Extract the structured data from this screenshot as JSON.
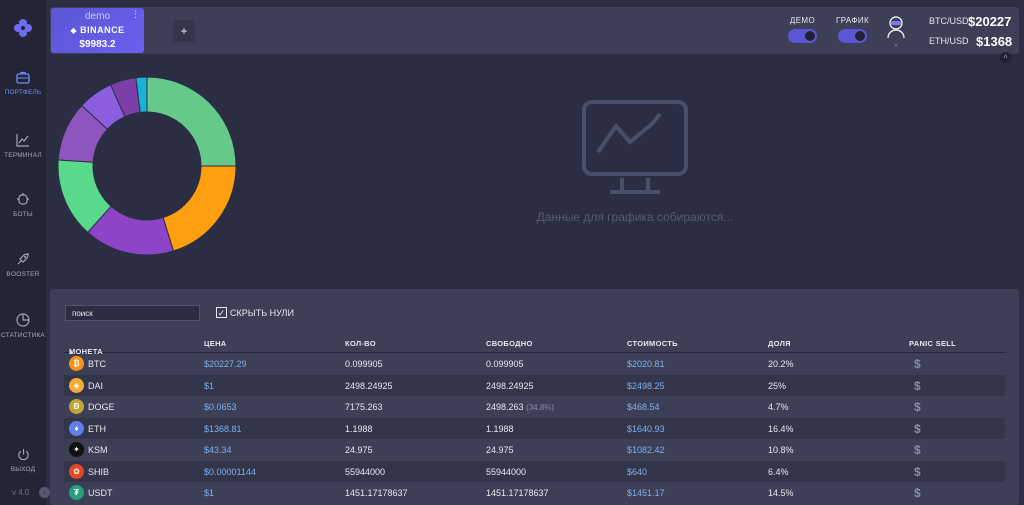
{
  "sidebar": {
    "items": [
      {
        "label": "ПОРТФЕЛЬ",
        "icon": "briefcase-icon",
        "active": true
      },
      {
        "label": "ТЕРМИНАЛ",
        "icon": "chart-line-icon",
        "active": false
      },
      {
        "label": "БОТЫ",
        "icon": "robot-icon",
        "active": false
      },
      {
        "label": "BOOSTER",
        "icon": "rocket-icon",
        "active": false
      },
      {
        "label": "СТАТИСТИКА",
        "icon": "pie-chart-icon",
        "active": false
      }
    ],
    "logout_label": "ВЫХОД",
    "version": "v 4.0"
  },
  "topbar": {
    "account": {
      "mode": "demo",
      "exchange": "BINANCE",
      "balance": "$9983.2"
    },
    "add_label": "+",
    "toggles": [
      {
        "label": "ДЕМО",
        "on": true
      },
      {
        "label": "ГРАФИК",
        "on": true
      }
    ],
    "tickers": [
      {
        "pair": "BTC/USD",
        "price": "$20227"
      },
      {
        "pair": "ETH/USD",
        "price": "$1368"
      }
    ]
  },
  "graph": {
    "message": "Данные для графика собираются..."
  },
  "table": {
    "search_placeholder": "поиск",
    "hide_zero_label": "СКРЫТЬ НУЛИ",
    "headers": {
      "coin": "МОНЕТА",
      "price": "ЦЕНА",
      "qty": "КОЛ-ВО",
      "free": "СВОБОДНО",
      "value": "СТОИМОСТЬ",
      "share": "ДОЛЯ",
      "panic": "PANIC SELL"
    },
    "rows": [
      {
        "coin": "BTC",
        "price": "$20227.29",
        "qty": "0.099905",
        "free": "0.099905",
        "free_note": "",
        "value": "$2020.81",
        "share": "20.2%",
        "color": "#f7931a",
        "glyph": "₿"
      },
      {
        "coin": "DAI",
        "price": "$1",
        "qty": "2498.24925",
        "free": "2498.24925",
        "free_note": "",
        "value": "$2498.25",
        "share": "25%",
        "color": "#f5ac37",
        "glyph": "◈"
      },
      {
        "coin": "DOGE",
        "price": "$0.0653",
        "qty": "7175.263",
        "free": "2498.263",
        "free_note": "(34.8%)",
        "value": "$468.54",
        "share": "4.7%",
        "color": "#c2a633",
        "glyph": "Ð"
      },
      {
        "coin": "ETH",
        "price": "$1368.81",
        "qty": "1.1988",
        "free": "1.1988",
        "free_note": "",
        "value": "$1640.93",
        "share": "16.4%",
        "color": "#627eea",
        "glyph": "♦"
      },
      {
        "coin": "KSM",
        "price": "$43.34",
        "qty": "24.975",
        "free": "24.975",
        "free_note": "",
        "value": "$1082.42",
        "share": "10.8%",
        "color": "#111111",
        "glyph": "✦"
      },
      {
        "coin": "SHIB",
        "price": "$0.00001144",
        "qty": "55944000",
        "free": "55944000",
        "free_note": "",
        "value": "$640",
        "share": "6.4%",
        "color": "#e44826",
        "glyph": "✿"
      },
      {
        "coin": "USDT",
        "price": "$1",
        "qty": "1451.17178637",
        "free": "1451.17178637",
        "free_note": "",
        "value": "$1451.17",
        "share": "14.5%",
        "color": "#26a17b",
        "glyph": "₮"
      }
    ],
    "panic_glyph": "$"
  },
  "donut": {
    "segments": [
      {
        "share": 25.0,
        "color": "#65c98a"
      },
      {
        "share": 20.2,
        "color": "#ff9f0f"
      },
      {
        "share": 16.4,
        "color": "#8e44c6"
      },
      {
        "share": 14.5,
        "color": "#59d98a"
      },
      {
        "share": 10.8,
        "color": "#8e55bf"
      },
      {
        "share": 6.4,
        "color": "#8b5ee0"
      },
      {
        "share": 4.7,
        "color": "#7c3fa8"
      },
      {
        "share": 2.0,
        "color": "#18b3d6"
      }
    ]
  }
}
